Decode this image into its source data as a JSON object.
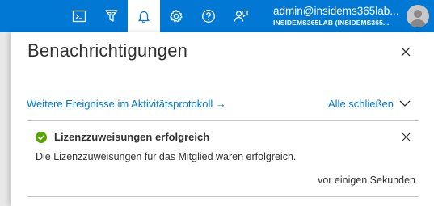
{
  "topbar": {
    "icons": [
      "cloud-shell-icon",
      "directory-filter-icon",
      "notifications-bell-icon",
      "settings-gear-icon",
      "help-icon",
      "feedback-icon"
    ],
    "account": {
      "name": "admin@insidems365lab...",
      "directory": "INSIDEMS365LAB (INSIDEMS365..."
    },
    "colors": {
      "background": "#0078d4",
      "foreground": "#ffffff"
    }
  },
  "panel": {
    "title": "Benachrichtigungen",
    "activity_log_link": "Weitere Ereignisse im Aktivitätsprotokoll →",
    "dismiss_all": "Alle schließen"
  },
  "notifications": [
    {
      "status": "success",
      "status_color": "#57a300",
      "title": "Lizenzzuweisungen erfolgreich",
      "body": "Die Lizenzzuweisungen für das Mitglied waren erfolgreich.",
      "time": "vor einigen Sekunden"
    }
  ]
}
